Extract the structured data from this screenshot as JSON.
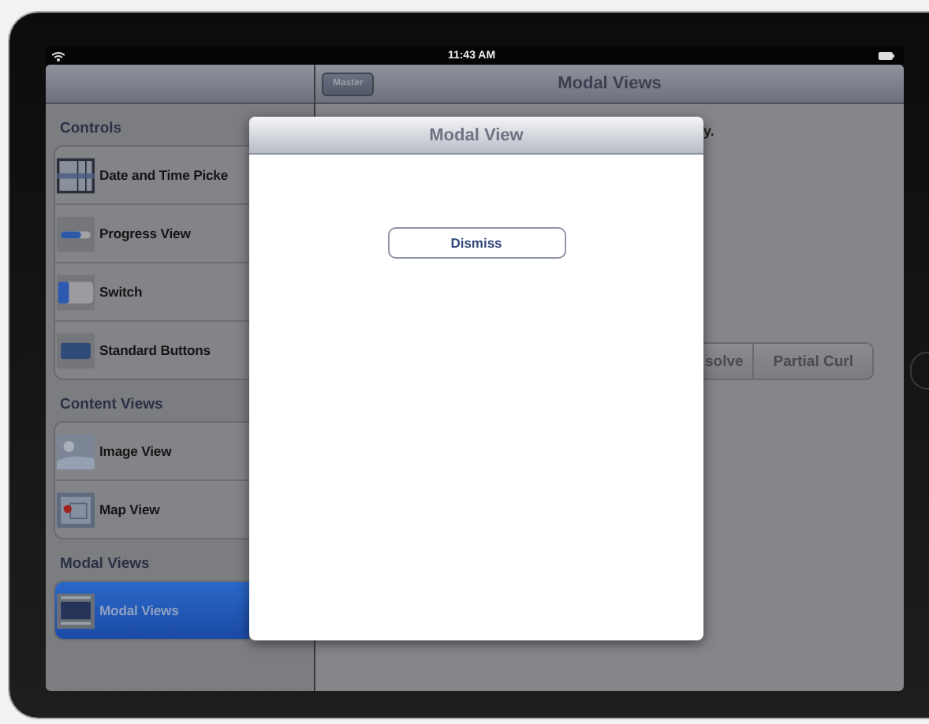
{
  "status_bar": {
    "time": "11:43 AM"
  },
  "master": {
    "sections": [
      {
        "header": "Controls",
        "items": [
          {
            "label": "Date and Time Picke",
            "kind": "picker",
            "selected": false
          },
          {
            "label": "Progress View",
            "kind": "progress",
            "selected": false
          },
          {
            "label": "Switch",
            "kind": "switch",
            "selected": false
          },
          {
            "label": "Standard Buttons",
            "kind": "button",
            "selected": false
          }
        ]
      },
      {
        "header": "Content Views",
        "items": [
          {
            "label": "Image View",
            "kind": "image",
            "selected": false
          },
          {
            "label": "Map View",
            "kind": "map",
            "selected": false
          }
        ]
      },
      {
        "header": "Modal Views",
        "items": [
          {
            "label": "Modal Views",
            "kind": "modal",
            "selected": true
          }
        ]
      }
    ]
  },
  "detail": {
    "title": "Modal Views",
    "back_button": "Master",
    "text_fragment": "y.",
    "segments": [
      {
        "label": "solve",
        "selected": false
      },
      {
        "label": "Partial Curl",
        "selected": false
      }
    ]
  },
  "modal": {
    "title": "Modal View",
    "button": "Dismiss"
  }
}
